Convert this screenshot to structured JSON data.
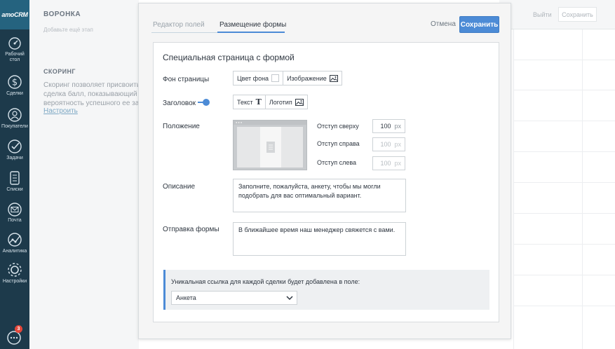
{
  "nav": {
    "logo": "amoCRM",
    "items": [
      {
        "label": "Рабочий стол",
        "icon": "dashboard-icon"
      },
      {
        "label": "Сделки",
        "icon": "dollar-icon"
      },
      {
        "label": "Покупатели",
        "icon": "customers-icon"
      },
      {
        "label": "Задачи",
        "icon": "check-icon"
      },
      {
        "label": "Списки",
        "icon": "lists-icon"
      },
      {
        "label": "Почта",
        "icon": "mail-icon"
      },
      {
        "label": "Аналитика",
        "icon": "analytics-icon"
      },
      {
        "label": "Настройки",
        "icon": "gear-icon"
      }
    ],
    "chat_badge": "3"
  },
  "background": {
    "title": "ВОРОНКА",
    "faint_text": "Добавьте ещё этап",
    "scoring_title": "СКОРИНГ",
    "scoring_text": [
      "Скоринг позволяет присвоить к",
      "сделка балл, показывающий",
      "вероятность успешного ее закр"
    ],
    "scoring_link": "Настроить",
    "exit": "Выйти",
    "save": "Сохранить"
  },
  "modal": {
    "tabs": [
      {
        "label": "Редактор полей",
        "active": false
      },
      {
        "label": "Размещение формы",
        "active": true
      }
    ],
    "cancel": "Отмена",
    "save": "Сохранить",
    "panel": {
      "title": "Специальная страница с формой",
      "page_bg": {
        "label": "Фон страницы",
        "color_option": "Цвет фона",
        "image_option": "Изображение"
      },
      "heading": {
        "label": "Заголовок",
        "enabled": true,
        "text_option": "Текст",
        "logo_option": "Логотип"
      },
      "position": {
        "label": "Положение",
        "offsets": [
          {
            "label": "Отступ сверху",
            "value": "100",
            "unit": "px",
            "disabled": false
          },
          {
            "label": "Отступ справа",
            "value": "100",
            "unit": "px",
            "disabled": true
          },
          {
            "label": "Отступ слева",
            "value": "100",
            "unit": "px",
            "disabled": true
          }
        ]
      },
      "description": {
        "label": "Описание",
        "value": "Заполните, пожалуйста, анкету, чтобы мы могли подобрать для вас оптимальный вариант."
      },
      "submit": {
        "label": "Отправка формы",
        "value": "В ближайшее время наш менеджер свяжется с вами."
      },
      "note": {
        "text": "Уникальная ссылка для каждой сделки будет добавлена в поле:",
        "select_value": "Анкета"
      }
    }
  },
  "colors": {
    "nav_bg": "#1d3a4b",
    "accent": "#4c8bd6",
    "badge": "#e4473a"
  }
}
